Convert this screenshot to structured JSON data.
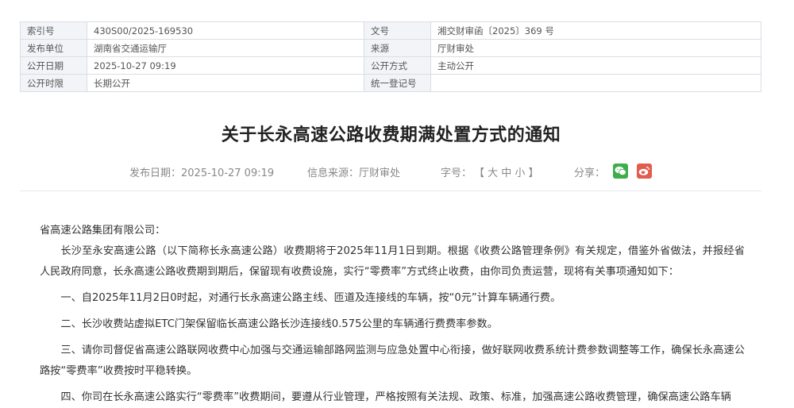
{
  "meta": {
    "rows": [
      {
        "l1": "索引号",
        "v1": "430S00/2025-169530",
        "l2": "文号",
        "v2": "湘交财审函〔2025〕369 号"
      },
      {
        "l1": "发布单位",
        "v1": "湖南省交通运输厅",
        "l2": "来源",
        "v2": "厅财审处"
      },
      {
        "l1": "公开日期",
        "v1": "2025-10-27 09:19",
        "l2": "公开方式",
        "v2": "主动公开"
      },
      {
        "l1": "公开时限",
        "v1": "长期公开",
        "l2": "统一登记号",
        "v2": ""
      }
    ]
  },
  "title": "关于长永高速公路收费期满处置方式的通知",
  "info": {
    "publish_date": "发布日期：2025-10-27 09:19",
    "source": "信息来源：厅财审处",
    "font_size_label": "字号：",
    "font_size_options": "【 大 中 小 】",
    "share_label": "分享：",
    "wechat_icon": "wechat-icon",
    "weibo_icon": "weibo-icon"
  },
  "content": {
    "salutation": "省高速公路集团有限公司：",
    "paragraphs": [
      "长沙至永安高速公路（以下简称长永高速公路）收费期将于2025年11月1日到期。根据《收费公路管理条例》有关规定，借鉴外省做法，并报经省人民政府同意，长永高速公路收费期到期后，保留现有收费设施，实行“零费率”方式终止收费，由你司负责运营，现将有关事项通知如下：",
      "一、自2025年11月2日0时起，对通行长永高速公路主线、匝道及连接线的车辆，按“0元”计算车辆通行费。",
      "二、长沙收费站虚拟ETC门架保留临长高速公路长沙连接线0.575公里的车辆通行费费率参数。",
      "三、请你司督促省高速公路联网收费中心加强与交通运输部路网监测与应急处置中心衔接，做好联网收费系统计费参数调整等工作，确保长永高速公路按“零费率”收费按时平稳转换。",
      "四、你司在长永高速公路实行“零费率”收费期间，要遵从行业管理，严格按照有关法规、政策、标准，加强高速公路收费管理，确保高速公路车辆"
    ]
  }
}
